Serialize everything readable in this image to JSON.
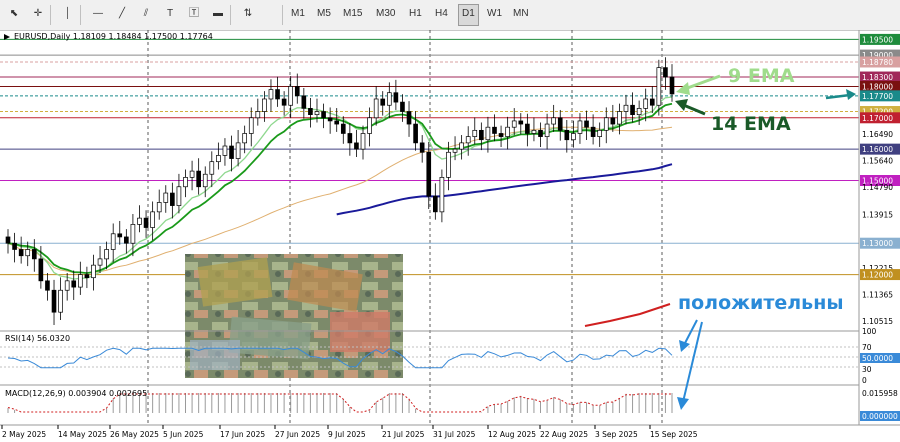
{
  "toolbar": {
    "tools": [
      {
        "name": "cursor-icon",
        "glyph": "⬉"
      },
      {
        "name": "crosshair-icon",
        "glyph": "✛"
      },
      {
        "name": "vertical-line-icon",
        "glyph": "│"
      },
      {
        "name": "horizontal-line-icon",
        "glyph": "—"
      },
      {
        "name": "trendline-icon",
        "glyph": "╱"
      },
      {
        "name": "equidistant-channel-icon",
        "glyph": "⫽"
      },
      {
        "name": "text-icon",
        "glyph": "T"
      },
      {
        "name": "text-label-icon",
        "glyph": "🅃"
      },
      {
        "name": "rectangle-icon",
        "glyph": "▬"
      },
      {
        "name": "arrows-icon",
        "glyph": "⇅"
      }
    ],
    "timeframes": [
      "M1",
      "M5",
      "M15",
      "M30",
      "H1",
      "H4",
      "D1",
      "W1",
      "MN"
    ],
    "active_timeframe": "D1"
  },
  "chart_data": [
    {
      "type": "candlestick",
      "symbol_info": "EURUSD,Daily  1.18109 1.18484 1.17500 1.17764",
      "x_tick_labels": [
        "2 May 2025",
        "14 May 2025",
        "26 May 2025",
        "5 Jun 2025",
        "17 Jun 2025",
        "27 Jun 2025",
        "9 Jul 2025",
        "21 Jul 2025",
        "31 Jul 2025",
        "12 Aug 2025",
        "22 Aug 2025",
        "3 Sep 2025",
        "15 Sep 2025"
      ],
      "y_tick_labels": [
        "1.19500",
        "1.19000",
        "1.18780",
        "1.18300",
        "1.18000",
        "1.17700",
        "1.17200",
        "1.17000",
        "1.16490",
        "1.16000",
        "1.15640",
        "1.15000",
        "1.14790",
        "1.13915",
        "1.13000",
        "1.12215",
        "1.12000",
        "1.11365",
        "1.10515"
      ],
      "ylim": [
        1.102,
        1.198
      ],
      "horizontal_levels": [
        {
          "price": 1.195,
          "label": "1.19500",
          "color": "#1e8c3c"
        },
        {
          "price": 1.19,
          "label": "1.19000",
          "color": "#8a8a8a"
        },
        {
          "price": 1.1878,
          "label": "1.18780",
          "color": "#d8a0a0"
        },
        {
          "price": 1.183,
          "label": "1.18300",
          "color": "#a0285a"
        },
        {
          "price": 1.18,
          "label": "1.18000",
          "color": "#7a1010"
        },
        {
          "price": 1.177,
          "label": "1.17700",
          "color": "#1a8a8a"
        },
        {
          "price": 1.172,
          "label": "1.17200",
          "color": "#d0b040"
        },
        {
          "price": 1.17,
          "label": "1.17000",
          "color": "#c02030"
        },
        {
          "price": 1.16,
          "label": "1.16000",
          "color": "#404080"
        },
        {
          "price": 1.15,
          "label": "1.15000",
          "color": "#c020c0"
        },
        {
          "price": 1.13,
          "label": "1.13000",
          "color": "#8ab0d0"
        },
        {
          "price": 1.12,
          "label": "1.12000",
          "color": "#c09020"
        }
      ],
      "closes": [
        1.13,
        1.128,
        1.126,
        1.128,
        1.125,
        1.118,
        1.115,
        1.108,
        1.115,
        1.118,
        1.116,
        1.12,
        1.119,
        1.123,
        1.125,
        1.128,
        1.133,
        1.132,
        1.13,
        1.136,
        1.138,
        1.135,
        1.14,
        1.143,
        1.146,
        1.142,
        1.148,
        1.151,
        1.153,
        1.148,
        1.152,
        1.156,
        1.158,
        1.161,
        1.157,
        1.162,
        1.165,
        1.17,
        1.172,
        1.176,
        1.179,
        1.176,
        1.174,
        1.18,
        1.177,
        1.173,
        1.171,
        1.172,
        1.17,
        1.169,
        1.168,
        1.165,
        1.162,
        1.16,
        1.165,
        1.17,
        1.176,
        1.174,
        1.178,
        1.175,
        1.172,
        1.168,
        1.162,
        1.159,
        1.145,
        1.14,
        1.151,
        1.159,
        1.16,
        1.162,
        1.164,
        1.166,
        1.163,
        1.167,
        1.165,
        1.164,
        1.167,
        1.169,
        1.168,
        1.165,
        1.166,
        1.164,
        1.168,
        1.17,
        1.166,
        1.163,
        1.165,
        1.169,
        1.167,
        1.164,
        1.166,
        1.17,
        1.168,
        1.172,
        1.174,
        1.171,
        1.173,
        1.176,
        1.174,
        1.186,
        1.183,
        1.1776
      ],
      "indicators": [
        {
          "name": "9 EMA",
          "color": "#8fd88f"
        },
        {
          "name": "14 EMA",
          "color": "#1a9a1a"
        },
        {
          "name": "",
          "color": "#e0b070"
        },
        {
          "name": "",
          "color": "#1a1a9a"
        },
        {
          "name": "",
          "color": "#d02020"
        }
      ]
    },
    {
      "type": "line",
      "label": "RSI(14) 56.0320",
      "y_tick_labels": [
        "100",
        "70",
        "50.0000",
        "30",
        "0"
      ],
      "ylim": [
        0,
        100
      ],
      "levels": [
        70,
        50,
        30
      ]
    },
    {
      "type": "bar",
      "label": "MACD(12,26,9) 0.003904 0.002695",
      "y_tick_labels": [
        "0.015958",
        "0.000000"
      ],
      "ylim": [
        0,
        0.016
      ]
    }
  ],
  "annotations": {
    "ema9": "9 EMA",
    "ema14": "14 EMA",
    "positive": "положительны"
  },
  "colors": {
    "ema9_text": "#a0dc8c",
    "ema14_text": "#1a5a28",
    "positive_text": "#2a8ad8",
    "arrow_teal": "#1a8a8a"
  }
}
